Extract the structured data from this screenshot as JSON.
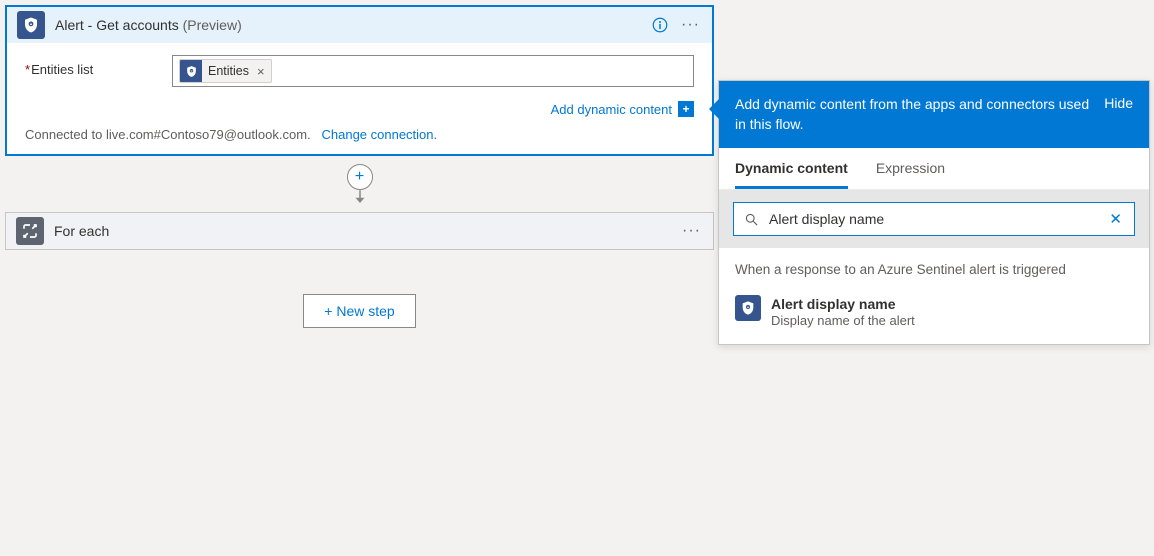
{
  "alertCard": {
    "title": "Alert - Get accounts",
    "titleSuffix": "(Preview)",
    "entitiesLabel": "Entities list",
    "token": {
      "label": "Entities"
    },
    "addDynamic": "Add dynamic content",
    "connectedPrefix": "Connected to ",
    "connectedAccount": "live.com#Contoso79@outlook.com.",
    "changeConnection": "Change connection."
  },
  "forEachCard": {
    "title": "For each"
  },
  "newStep": "+ New step",
  "panel": {
    "headerText": "Add dynamic content from the apps and connectors used in this flow.",
    "hide": "Hide",
    "tabs": {
      "dynamic": "Dynamic content",
      "expression": "Expression"
    },
    "searchValue": "Alert display name",
    "sectionTitle": "When a response to an Azure Sentinel alert is triggered",
    "result": {
      "name": "Alert display name",
      "desc": "Display name of the alert"
    }
  }
}
